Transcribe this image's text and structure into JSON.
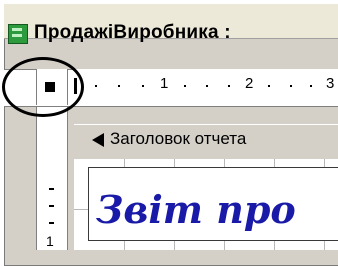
{
  "window": {
    "title": "ПродажіВиробника :"
  },
  "ruler": {
    "numbers": [
      "1",
      "2",
      "3"
    ]
  },
  "left_ruler": {
    "number": "1"
  },
  "section": {
    "label": "Заголовок отчета"
  },
  "report": {
    "title_text": "Звіт про"
  },
  "icons": {
    "app": "form-app-icon",
    "selector": "report-selector-icon",
    "section_arrow": "arrow-left-icon"
  },
  "colors": {
    "report_title": "#1a1aa8",
    "chrome": "#d4d0c8",
    "app_icon": "#2e9a3e"
  }
}
